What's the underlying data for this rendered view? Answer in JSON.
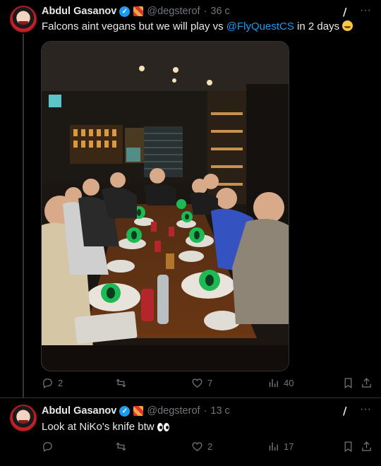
{
  "tweets": [
    {
      "author": "Abdul Gasanov",
      "handle": "@degsterof",
      "separator": "·",
      "time": "36 с",
      "text_prefix": "Falcons aint vegans but we will play vs ",
      "mention": "@FlyQuestCS",
      "text_suffix": " in 2 days",
      "stats": {
        "replies": "2",
        "retweets": "",
        "likes": "7",
        "views": "40"
      }
    },
    {
      "author": "Abdul Gasanov",
      "handle": "@degsterof",
      "separator": "·",
      "time": "13 с",
      "text": "Look at NiKo's knife btw",
      "stats": {
        "replies": "",
        "retweets": "",
        "likes": "2",
        "views": "17"
      }
    }
  ],
  "icons": {
    "grok": "grok-icon",
    "more": "more-icon",
    "reply": "reply-icon",
    "retweet": "retweet-icon",
    "like": "like-icon",
    "views": "views-icon",
    "bookmark": "bookmark-icon",
    "share": "share-icon"
  },
  "colors": {
    "accent": "#1d9bf0",
    "muted": "#71767b",
    "text": "#e7e9ea",
    "background": "#000000"
  }
}
